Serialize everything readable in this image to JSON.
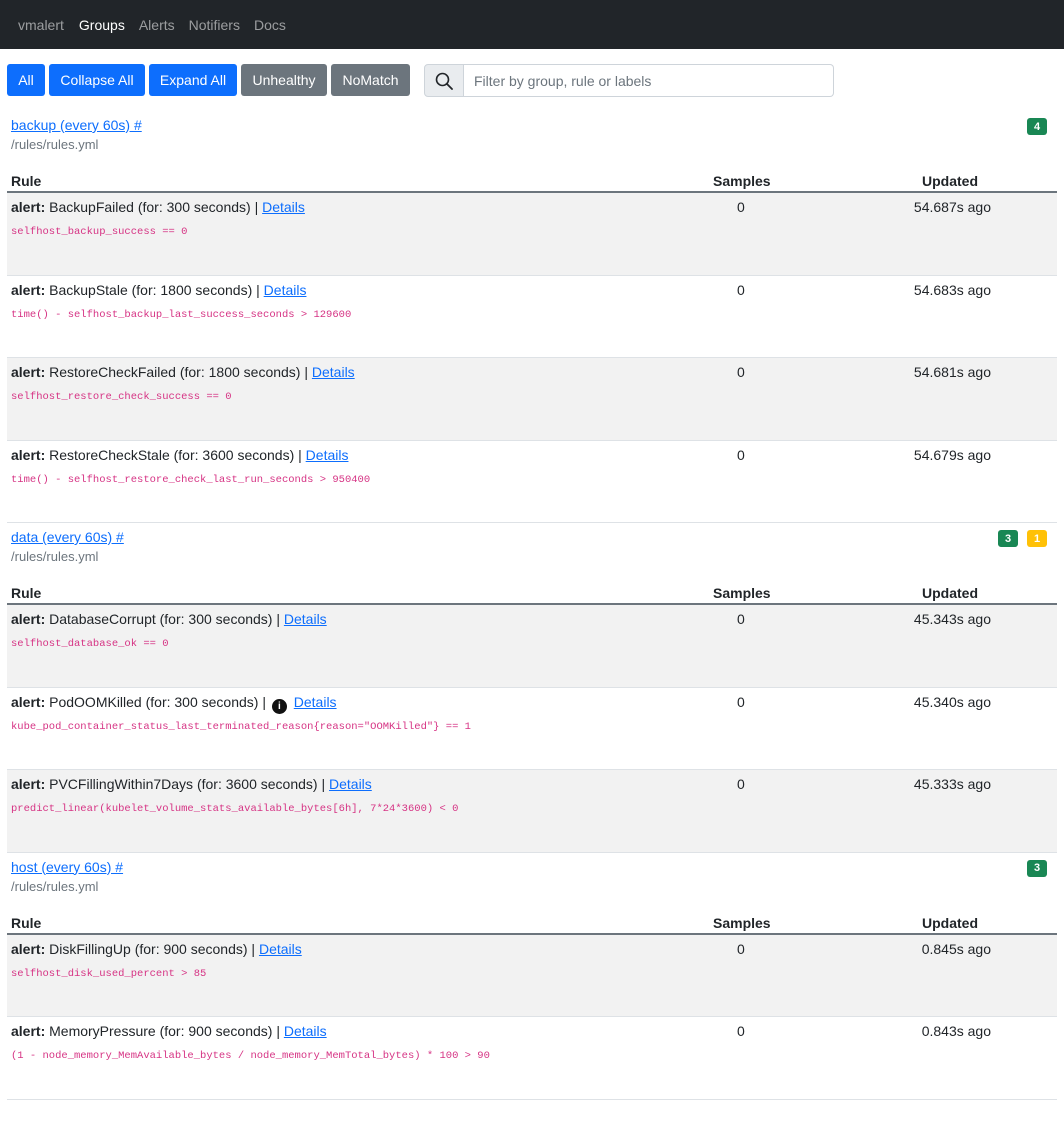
{
  "nav": {
    "brand": "vmalert",
    "links": [
      "Groups",
      "Alerts",
      "Notifiers",
      "Docs"
    ]
  },
  "toolbar": {
    "all": "All",
    "collapse_all": "Collapse All",
    "expand_all": "Expand All",
    "unhealthy": "Unhealthy",
    "nomatch": "NoMatch",
    "search_placeholder": "Filter by group, rule or labels",
    "search_value": ""
  },
  "table_headers": {
    "rule": "Rule",
    "samples": "Samples",
    "updated": "Updated"
  },
  "labels": {
    "alert": "alert:",
    "details": "Details",
    "sep": "|"
  },
  "groups": [
    {
      "title": "backup (every 60s) #",
      "file": "/rules/rules.yml",
      "badges": [
        {
          "count": "4",
          "color": "#198754"
        }
      ],
      "rules": [
        {
          "name": "BackupFailed (for: 300 seconds)",
          "expr": "selfhost_backup_success == 0",
          "samples": "0",
          "updated": "54.687s ago"
        },
        {
          "name": "BackupStale (for: 1800 seconds)",
          "expr": "time() - selfhost_backup_last_success_seconds > 129600",
          "samples": "0",
          "updated": "54.683s ago"
        },
        {
          "name": "RestoreCheckFailed (for: 1800 seconds)",
          "expr": "selfhost_restore_check_success == 0",
          "samples": "0",
          "updated": "54.681s ago"
        },
        {
          "name": "RestoreCheckStale (for: 3600 seconds)",
          "expr": "time() - selfhost_restore_check_last_run_seconds > 950400",
          "samples": "0",
          "updated": "54.679s ago"
        }
      ]
    },
    {
      "title": "data (every 60s) #",
      "file": "/rules/rules.yml",
      "badges": [
        {
          "count": "3",
          "color": "#198754"
        },
        {
          "count": "1",
          "color": "#ffc107"
        }
      ],
      "rules": [
        {
          "name": "DatabaseCorrupt (for: 300 seconds)",
          "expr": "selfhost_database_ok == 0",
          "samples": "0",
          "updated": "45.343s ago"
        },
        {
          "name": "PodOOMKilled (for: 300 seconds)",
          "expr": "kube_pod_container_status_last_terminated_reason{reason=\"OOMKilled\"} == 1",
          "samples": "0",
          "updated": "45.340s ago",
          "info": "i"
        },
        {
          "name": "PVCFillingWithin7Days (for: 3600 seconds)",
          "expr": "predict_linear(kubelet_volume_stats_available_bytes[6h], 7*24*3600) < 0",
          "samples": "0",
          "updated": "45.333s ago"
        }
      ]
    },
    {
      "title": "host (every 60s) #",
      "file": "/rules/rules.yml",
      "badges": [
        {
          "count": "3",
          "color": "#198754"
        }
      ],
      "rules": [
        {
          "name": "DiskFillingUp (for: 900 seconds)",
          "expr": "selfhost_disk_used_percent > 85",
          "samples": "0",
          "updated": "0.845s ago"
        },
        {
          "name": "MemoryPressure (for: 900 seconds)",
          "expr": "(1 - node_memory_MemAvailable_bytes / node_memory_MemTotal_bytes) * 100 > 90",
          "samples": "0",
          "updated": "0.843s ago"
        }
      ]
    }
  ]
}
